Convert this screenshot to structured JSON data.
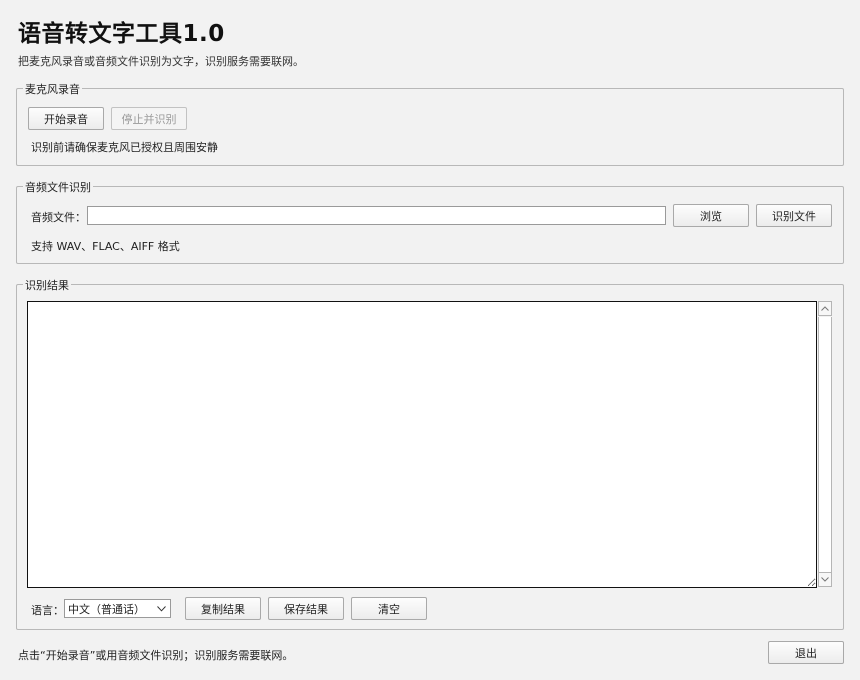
{
  "app": {
    "title": "语音转文字工具1.0",
    "subtitle": "把麦克风录音或音频文件识别为文字，识别服务需要联网。"
  },
  "mic_group": {
    "legend": "麦克风录音",
    "start_label": "开始录音",
    "stop_label": "停止并识别",
    "hint": "识别前请确保麦克风已授权且周围安静"
  },
  "file_group": {
    "legend": "音频文件识别",
    "file_label": "音频文件：",
    "file_value": "",
    "browse_label": "浏览",
    "recognize_label": "识别文件",
    "formats_hint": "支持 WAV、FLAC、AIFF 格式"
  },
  "result_group": {
    "legend": "识别结果",
    "result_text": "",
    "language_label": "语言：",
    "language_selected": "中文（普通话）",
    "copy_label": "复制结果",
    "save_label": "保存结果",
    "clear_label": "清空"
  },
  "footer": {
    "status": "点击“开始录音”或用音频文件识别；识别服务需要联网。",
    "exit_label": "退出"
  },
  "icons": {
    "scroll_up": "chevron-up-icon",
    "scroll_down": "chevron-down-icon",
    "select_arrow": "chevron-down-icon"
  }
}
